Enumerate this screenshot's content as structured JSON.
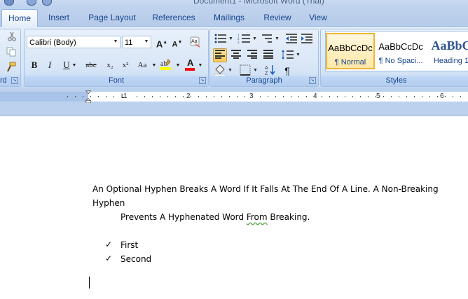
{
  "window": {
    "title": "Document1 - Microsoft Word (Trial)"
  },
  "tabs": [
    {
      "label": "Home"
    },
    {
      "label": "Insert"
    },
    {
      "label": "Page Layout"
    },
    {
      "label": "References"
    },
    {
      "label": "Mailings"
    },
    {
      "label": "Review"
    },
    {
      "label": "View"
    }
  ],
  "clipboard": {
    "label_partial": "rd"
  },
  "font_group": {
    "label": "Font",
    "font_name": "Calibri (Body)",
    "font_size": "11",
    "buttons": {
      "grow": "A",
      "shrink": "A",
      "bold": "B",
      "italic": "I",
      "underline": "U",
      "strike": "abc",
      "subscript": "x₂",
      "superscript": "x²",
      "case": "Aa",
      "font_color": "A"
    }
  },
  "paragraph_group": {
    "label": "Paragraph",
    "pilcrow": "¶"
  },
  "styles_group": {
    "label": "Styles",
    "items": [
      {
        "sample": "AaBbCcDc",
        "name": "¶ Normal"
      },
      {
        "sample": "AaBbCcDc",
        "name": "¶ No Spaci..."
      },
      {
        "sample": "AaBbC",
        "name": "Heading 1"
      }
    ]
  },
  "ruler": {
    "numbers": [
      "1",
      "2",
      "3",
      "4",
      "5",
      "6"
    ]
  },
  "document": {
    "paragraph_line1": "An Optional Hyphen Breaks A Word If It Falls At The End Of A Line. A Non-Breaking Hyphen",
    "paragraph_line2_before": "Prevents A Hyphenated Word ",
    "paragraph_line2_squiggle": "From",
    "paragraph_line2_after": " Breaking.",
    "bullets": [
      {
        "mark": "✓",
        "text": "First"
      },
      {
        "mark": "✓",
        "text": "Second"
      }
    ]
  },
  "colors": {
    "ribbon_text": "#15428b",
    "highlight": "#ffff00",
    "font_color_bar": "#ff0000",
    "selected_style": "#f0b43a"
  }
}
